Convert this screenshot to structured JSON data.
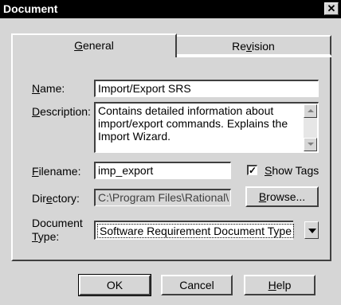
{
  "dialog": {
    "title": "Document",
    "close_glyph": "✕"
  },
  "tabs": [
    {
      "label": "General",
      "accel": "G",
      "rest": "eneral",
      "active": true
    },
    {
      "label": "Revision",
      "pre": "Re",
      "accel": "v",
      "rest": "ision",
      "active": false
    }
  ],
  "form": {
    "name": {
      "label_accel": "N",
      "label_rest": "ame:",
      "value": "Import/Export SRS"
    },
    "description": {
      "label_accel": "D",
      "label_rest": "escription:",
      "value": "Contains detailed information about import/export commands. Explains the Import Wizard."
    },
    "filename": {
      "label_accel": "F",
      "label_rest": "ilename:",
      "value": "imp_export"
    },
    "show_tags": {
      "accel": "S",
      "rest": "how Tags",
      "checked": true,
      "mark": "✓"
    },
    "directory": {
      "label_pre": "Dir",
      "label_accel": "e",
      "label_rest": "ctory:",
      "value": "C:\\Program Files\\Rational\\"
    },
    "browse": {
      "accel": "B",
      "rest": "rowse..."
    },
    "doc_type": {
      "label_line1": "Document",
      "label_accel": "T",
      "label_rest": "ype:",
      "value": "Software Requirement Document Type"
    }
  },
  "buttons": {
    "ok": "OK",
    "cancel": "Cancel",
    "help": {
      "accel": "H",
      "rest": "elp"
    }
  }
}
